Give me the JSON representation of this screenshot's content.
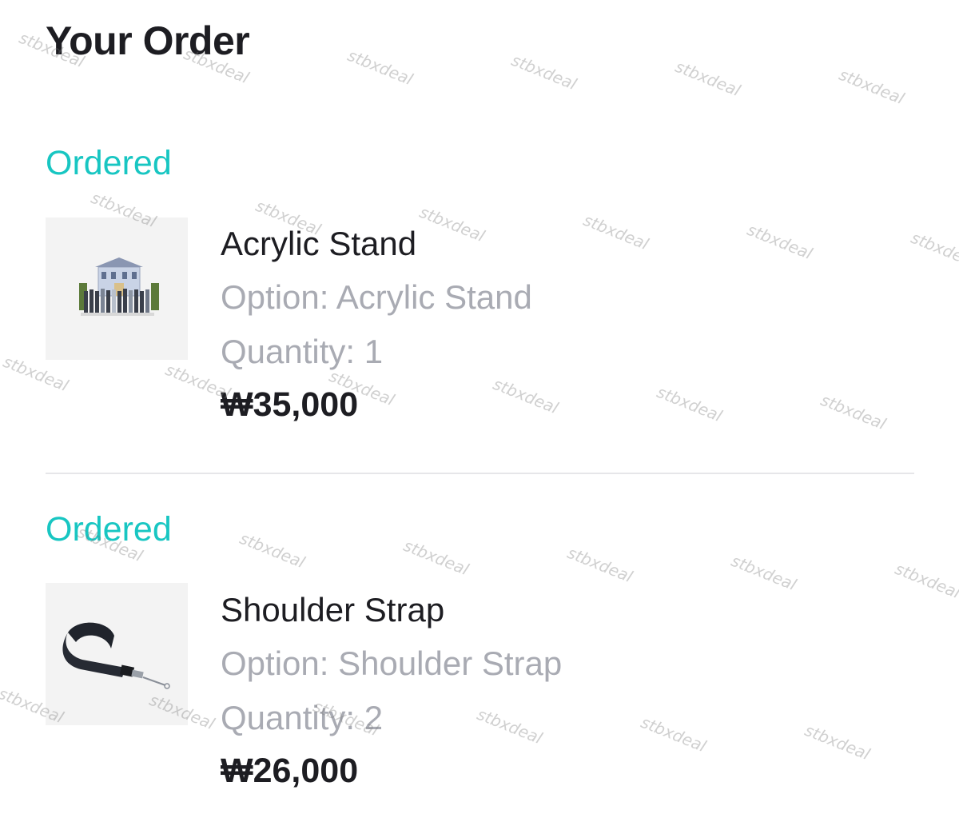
{
  "page": {
    "title": "Your Order"
  },
  "orders": [
    {
      "status": "Ordered",
      "name": "Acrylic Stand",
      "option": "Option: Acrylic Stand",
      "quantity": "Quantity: 1",
      "price": "₩35,000",
      "image_icon": "acrylic-stand-product-image"
    },
    {
      "status": "Ordered",
      "name": "Shoulder Strap",
      "option": "Option: Shoulder Strap",
      "quantity": "Quantity: 2",
      "price": "₩26,000",
      "image_icon": "shoulder-strap-product-image"
    }
  ],
  "watermark": {
    "text": "stbxdeal"
  },
  "colors": {
    "status": "#18c6c2",
    "muted": "#a9abb3",
    "text": "#1d1d22",
    "divider": "#e6e6e9"
  }
}
